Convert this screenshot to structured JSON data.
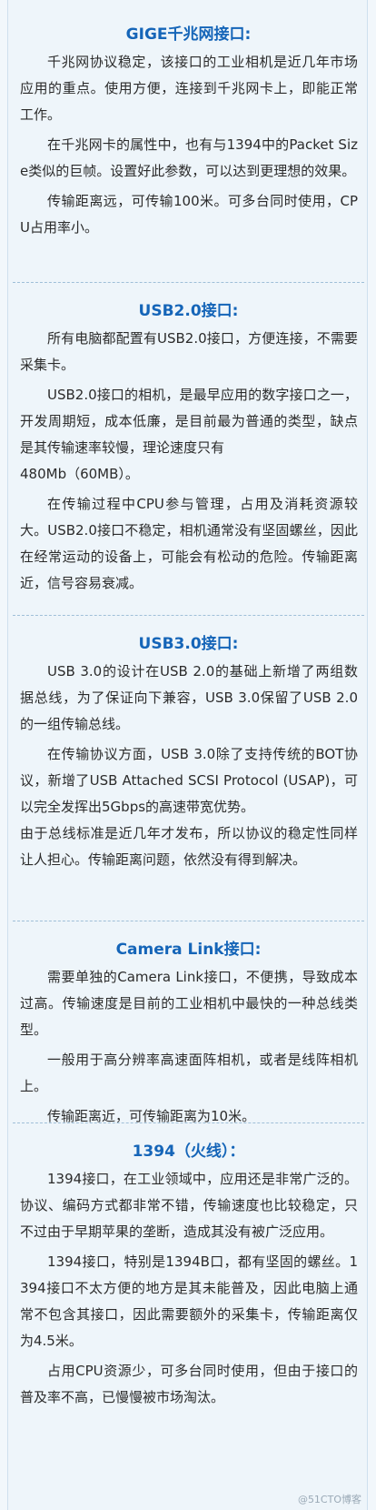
{
  "sections": [
    {
      "title": "GIGE千兆网接口:",
      "paragraphs": [
        "千兆网协议稳定，该接口的工业相机是近几年市场应用的重点。使用方便，连接到千兆网卡上，即能正常工作。",
        "在千兆网卡的属性中，也有与1394中的Packet Size类似的巨帧。设置好此参数，可以达到更理想的效果。",
        "传输距离远，可传输100米。可多台同时使用，CPU占用率小。"
      ]
    },
    {
      "title": "USB2.0接口:",
      "paragraphs": [
        "所有电脑都配置有USB2.0接口，方便连接，不需要采集卡。",
        "USB2.0接口的相机，是最早应用的数字接口之一，开发周期短，成本低廉，是目前最为普通的类型，缺点是其传输速率较慢，理论速度只有",
        "480Mb（60MB）。",
        "在传输过程中CPU参与管理，占用及消耗资源较大。USB2.0接口不稳定，相机通常没有坚固螺丝，因此在经常运动的设备上，可能会有松动的危险。传输距离近，信号容易衰减。"
      ]
    },
    {
      "title": "USB3.0接口:",
      "paragraphs": [
        "USB 3.0的设计在USB 2.0的基础上新增了两组数据总线，为了保证向下兼容，USB 3.0保留了USB 2.0的一组传输总线。",
        "在传输协议方面，USB 3.0除了支持传统的BOT协议，新增了USB Attached SCSI Protocol (USAP)，可以完全发挥出5Gbps的高速带宽优势。",
        "由于总线标准是近几年才发布，所以协议的稳定性同样让人担心。传输距离问题，依然没有得到解决。"
      ]
    },
    {
      "title": "Camera Link接口:",
      "paragraphs": [
        "需要单独的Camera Link接口，不便携，导致成本过高。传输速度是目前的工业相机中最快的一种总线类型。",
        "一般用于高分辨率高速面阵相机，或者是线阵相机上。",
        "传输距离近，可传输距离为10米。"
      ]
    },
    {
      "title": "1394（火线）：",
      "paragraphs": [
        "1394接口，在工业领域中，应用还是非常广泛的。协议、编码方式都非常不错，传输速度也比较稳定，只不过由于早期苹果的垄断，造成其没有被广泛应用。",
        "1394接口，特别是1394B口，都有坚固的螺丝。1394接口不太方便的地方是其未能普及，因此电脑上通常不包含其接口，因此需要额外的采集卡，传输距离仅为4.5米。",
        "占用CPU资源少，可多台同时使用，但由于接口的普及率不高，已慢慢被市场淘汰。"
      ]
    }
  ],
  "watermark": "@51CTO博客"
}
